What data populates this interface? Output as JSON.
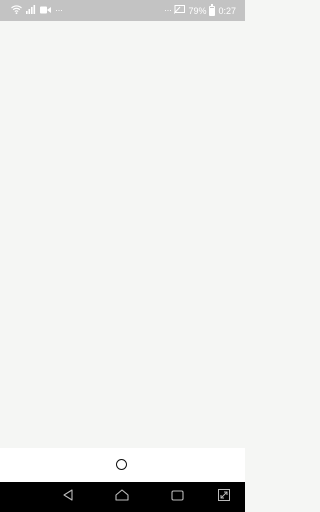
{
  "status_bar": {
    "left_overflow": "···",
    "right_overflow": "···",
    "battery_text": "79%",
    "time": "0:27",
    "background": "#c3c3c3"
  },
  "content": {
    "background": "#f5f6f4"
  },
  "nav_bar": {
    "background": "#000000"
  }
}
